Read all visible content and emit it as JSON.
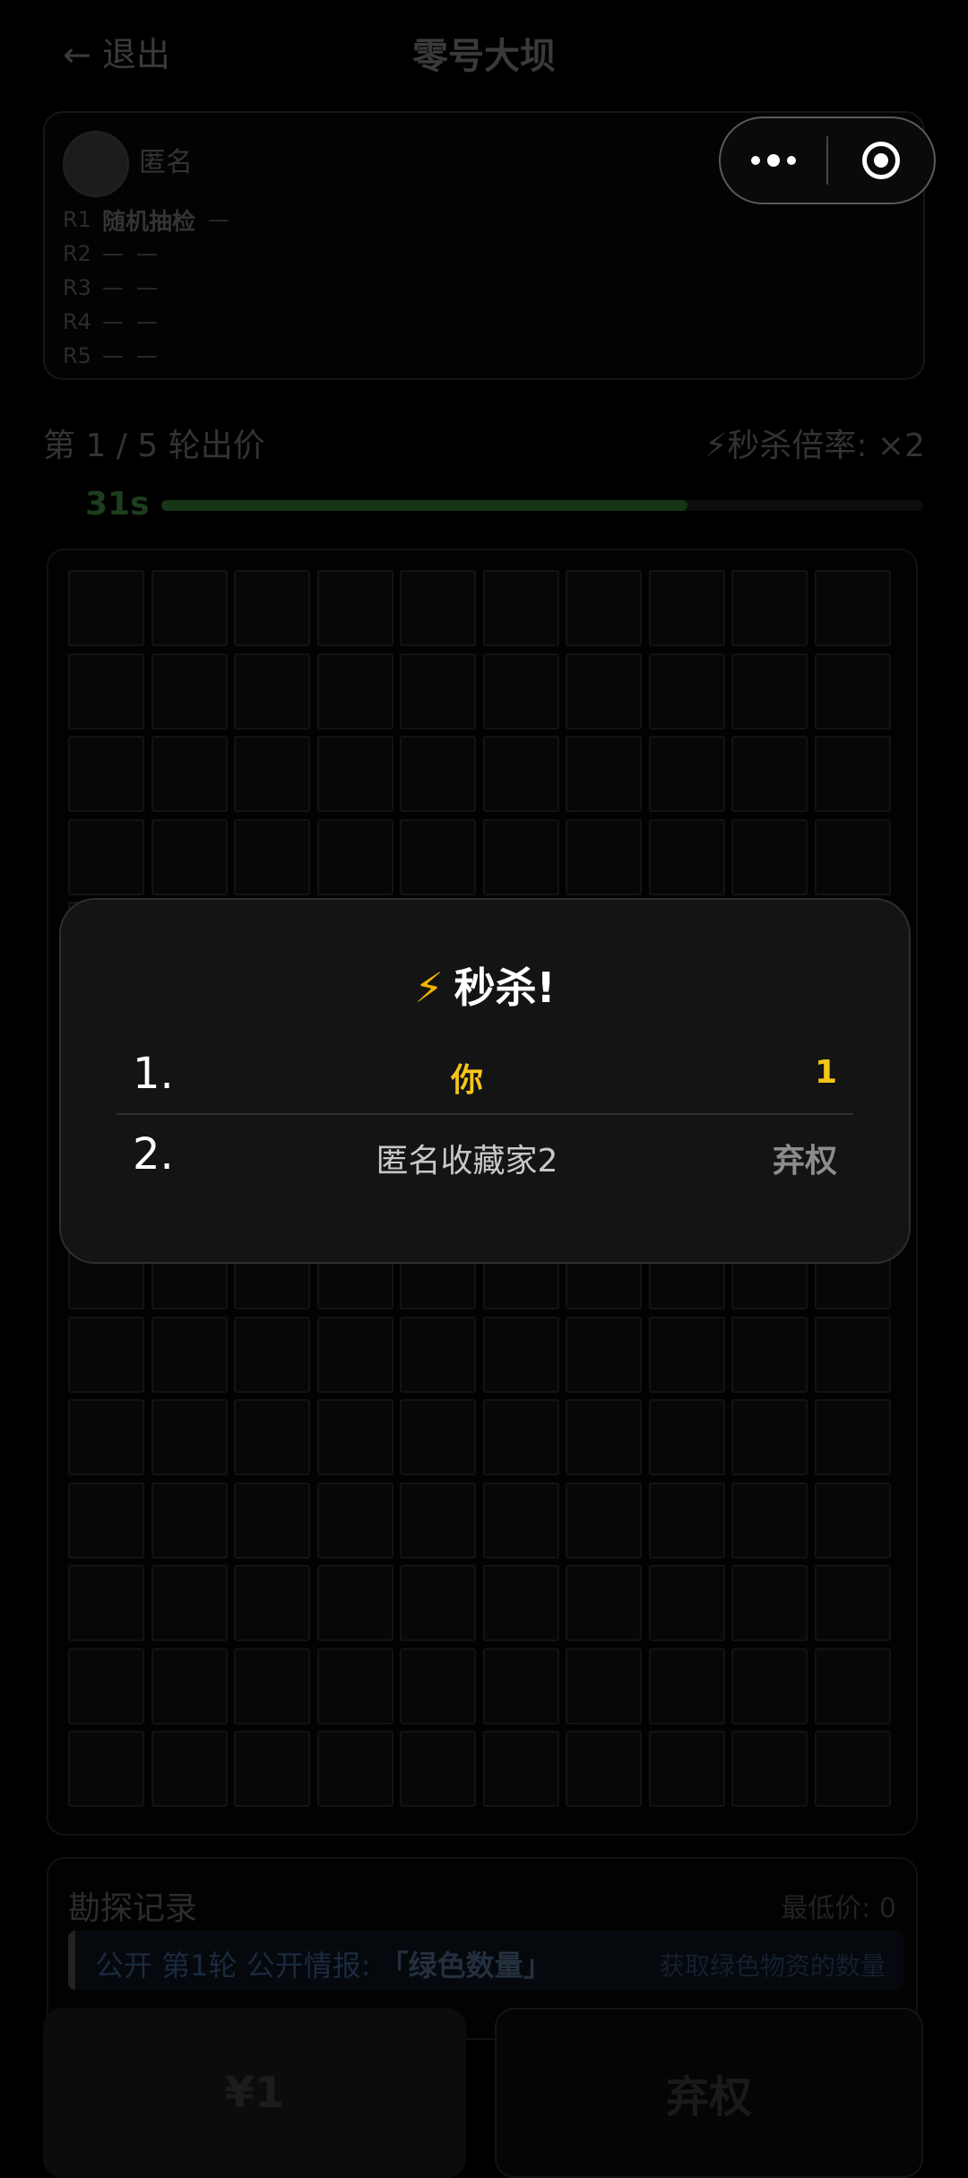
{
  "header": {
    "back_label": "← 退出",
    "title": "零号大坝"
  },
  "player": {
    "name": "匿名",
    "rounds": [
      {
        "label": "R1",
        "value": "随机抽检",
        "extra": "—"
      },
      {
        "label": "R2",
        "value": "—",
        "extra": "—"
      },
      {
        "label": "R3",
        "value": "—",
        "extra": "—"
      },
      {
        "label": "R4",
        "value": "—",
        "extra": "—"
      },
      {
        "label": "R5",
        "value": "—",
        "extra": "—"
      }
    ]
  },
  "auction": {
    "round_label": "第 1 / 5 轮出价",
    "multiplier_label": "⚡秒杀倍率: ×2",
    "timer_label": "31s",
    "progress_fraction": 0.69
  },
  "board": {
    "cols": 10,
    "rows": 15
  },
  "record": {
    "title": "勘探记录",
    "min_price": "最低价: 0",
    "item_text_prefix": "公开 第1轮 公开情报: ",
    "item_text_bold": "「绿色数量」",
    "item_desc": "获取绿色物资的数量"
  },
  "actions": {
    "bid_label": "¥1",
    "pass_label": "弃权"
  },
  "modal": {
    "title_icon": "⚡",
    "title": "秒杀!",
    "results": [
      {
        "rank": "1.",
        "name": "你",
        "value": "1"
      },
      {
        "rank": "2.",
        "name": "匿名收藏家2",
        "value": "弃权"
      }
    ]
  },
  "colors": {
    "accent_yellow": "#f5c518",
    "bolt": "#f4b400",
    "progress_green": "#173617"
  }
}
